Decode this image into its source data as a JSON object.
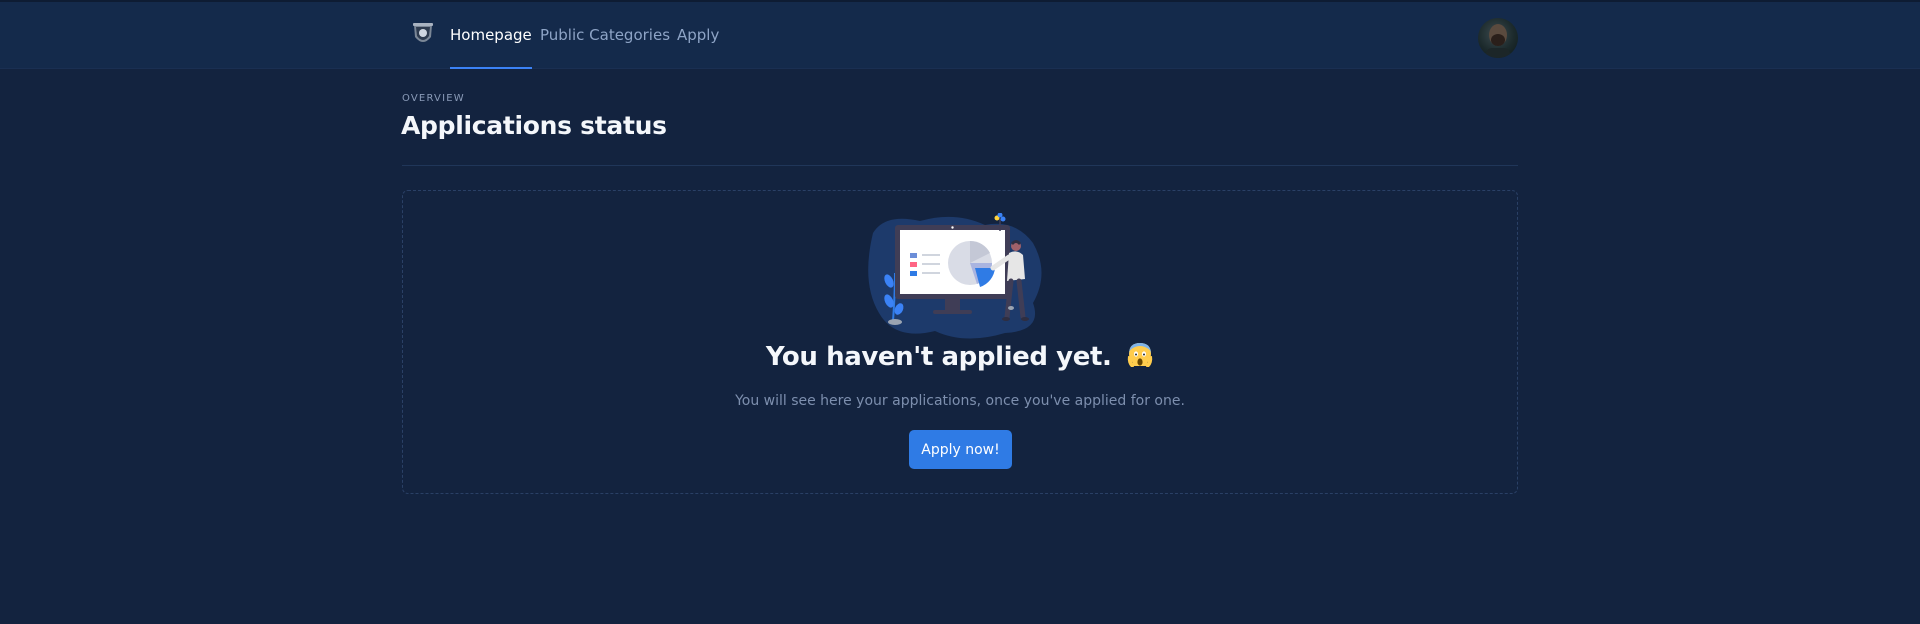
{
  "nav": {
    "items": [
      {
        "label": "Homepage",
        "active": true
      },
      {
        "label": "Public Categories",
        "active": false
      },
      {
        "label": "Apply",
        "active": false
      }
    ]
  },
  "header": {
    "eyebrow": "OVERVIEW",
    "title": "Applications status"
  },
  "empty_state": {
    "title": "You haven't applied yet.",
    "emoji": "face-screaming-in-fear",
    "subtitle": "You will see here your applications, once you've applied for one.",
    "button_label": "Apply now!"
  },
  "colors": {
    "background": "#13233f",
    "topbar": "#142a4b",
    "accent": "#2f7be5",
    "active_underline": "#3b82f6"
  }
}
